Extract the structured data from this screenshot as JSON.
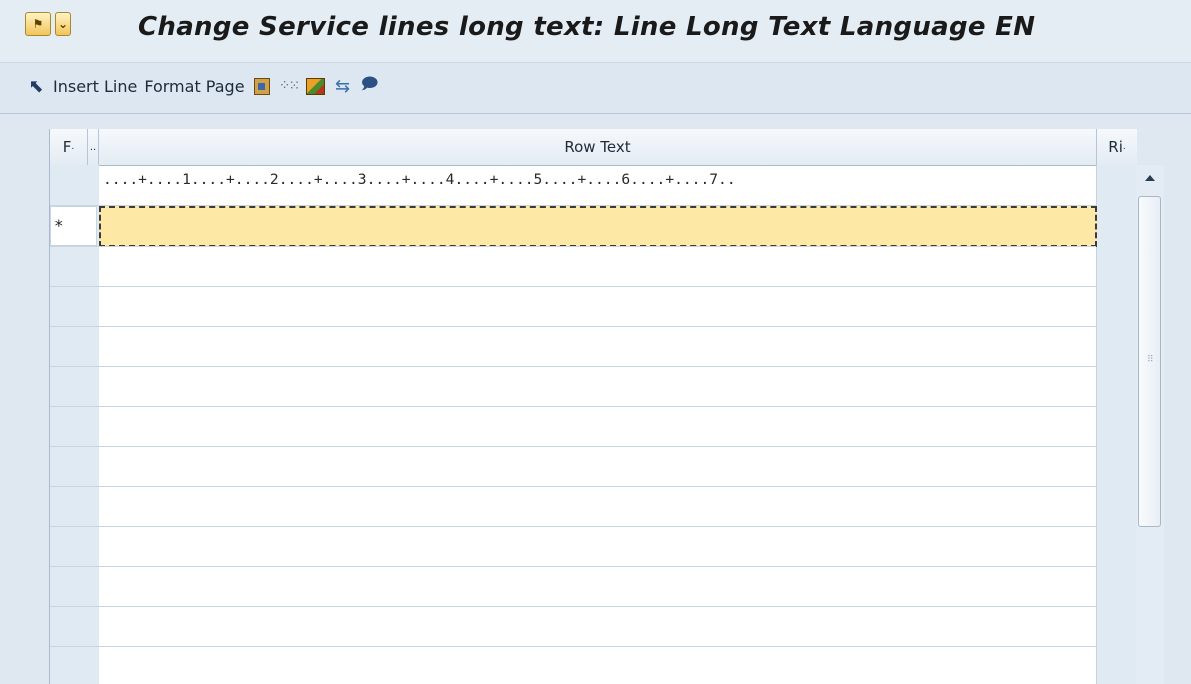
{
  "title": {
    "text": "Change Service lines long text: Line Long Text Language EN",
    "icons": [
      "help-icon",
      "menu-dropdown-icon"
    ]
  },
  "toolbar": {
    "items": [
      {
        "name": "select-icon",
        "type": "icon"
      },
      {
        "name": "insert-line",
        "label": "Insert Line"
      },
      {
        "name": "format-page",
        "label": "Format Page"
      },
      {
        "name": "paste-icon",
        "type": "icon"
      },
      {
        "name": "dotted-icon",
        "type": "icon"
      },
      {
        "name": "image-icon",
        "type": "icon"
      },
      {
        "name": "move-icon",
        "type": "icon"
      },
      {
        "name": "comment-icon",
        "type": "icon"
      }
    ]
  },
  "grid": {
    "headers": {
      "format": "F",
      "col2": "..",
      "row_text": "Row Text",
      "right": "Ri"
    },
    "ruler": "....+....1....+....2....+....3....+....4....+....5....+....6....+....7..",
    "first_row_marker": "*",
    "active_row_value": ""
  }
}
